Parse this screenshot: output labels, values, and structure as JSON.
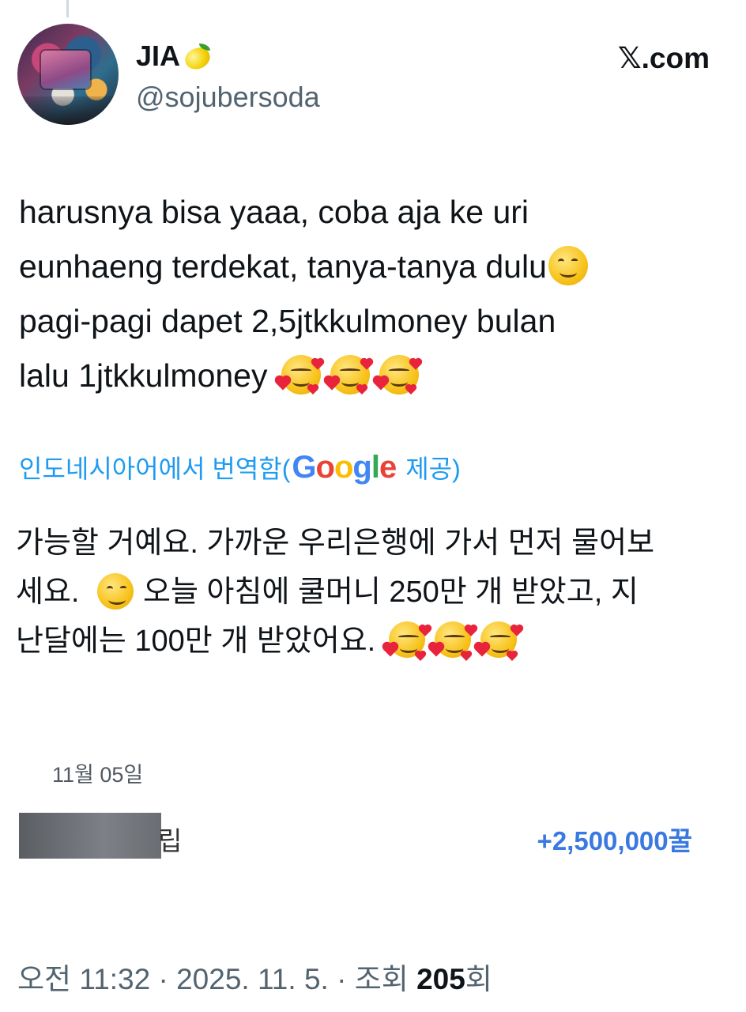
{
  "author": {
    "display_name": "JIA",
    "handle": "@sojubersoda",
    "avatar_icon": "concert-photo-avatar",
    "badge_icon": "lemon-emoji"
  },
  "site": {
    "label": "𝕏.com"
  },
  "tweet": {
    "lines": [
      "harusnya bisa yaaa, coba aja ke uri",
      "eunhaeng terdekat, tanya-tanya dulu",
      "pagi-pagi dapet 2,5jtkkulmoney bulan",
      "lalu 1jtkkulmoney"
    ]
  },
  "translation": {
    "label": "인도네시아어에서 번역함(",
    "provider_letters": [
      "G",
      "o",
      "o",
      "g",
      "l",
      "e"
    ],
    "provider_suffix": "제공)",
    "line1": "가능할 거예요. 가까운 우리은행에 가서 먼저 물어보",
    "line2a": "세요.",
    "line2b": "오늘 아침에 쿨머니 250만 개 받았고, 지",
    "line3": "난달에는 100만 개 받았어요."
  },
  "embedded_screenshot": {
    "date": "11월 05일",
    "description_suffix": "립",
    "amount": "+2,500,000꿀"
  },
  "meta": {
    "time": "오전 11:32",
    "separator": " · ",
    "date": "2025. 11. 5.",
    "views_label": "조회",
    "views_count": "205",
    "views_suffix": "회"
  },
  "colors": {
    "link_blue": "#1d9bf0",
    "amount_blue": "#3a79e0",
    "muted_gray": "#536471"
  }
}
